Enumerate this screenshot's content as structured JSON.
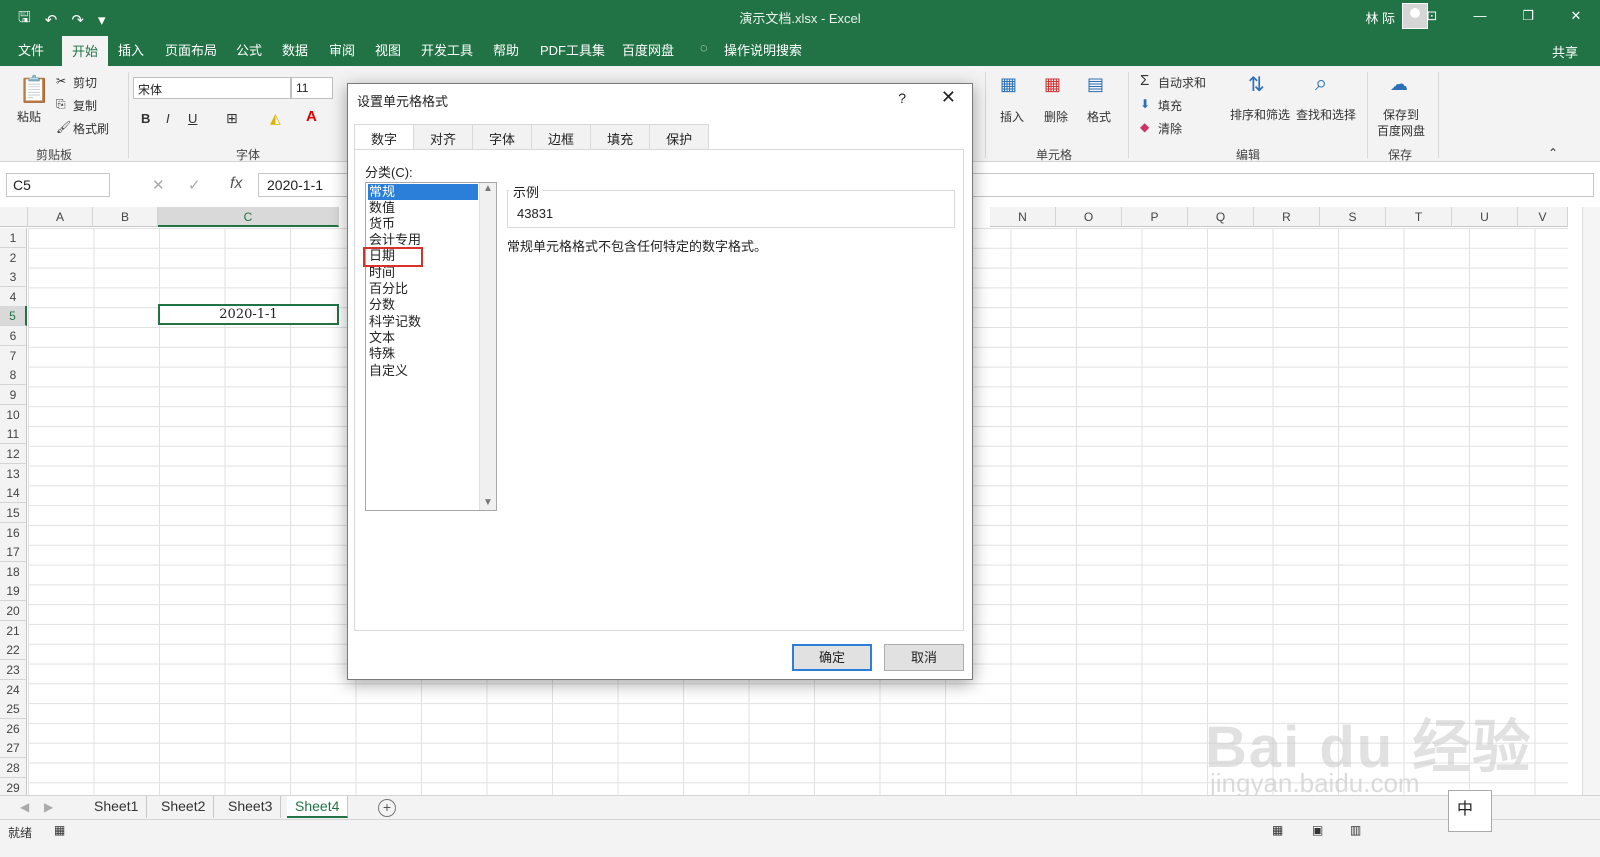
{
  "window": {
    "title": "演示文档.xlsx - Excel",
    "user": "林 际",
    "min": "—",
    "restore": "❐",
    "close": "✕",
    "ribbon_display": "⊡"
  },
  "ribbon_tabs": [
    "文件",
    "开始",
    "插入",
    "页面布局",
    "公式",
    "数据",
    "审阅",
    "视图",
    "开发工具",
    "帮助",
    "PDF工具集",
    "百度网盘",
    "操作说明搜索"
  ],
  "share": "共享",
  "ribbon": {
    "clipboard": {
      "paste": "粘贴",
      "cut": "剪切",
      "copy": "复制",
      "format_painter": "格式刷",
      "group": "剪贴板"
    },
    "font": {
      "name": "宋体",
      "size": "11",
      "group": "字体",
      "bold": "B",
      "italic": "I",
      "underline": "U"
    },
    "cells": {
      "insert": "插入",
      "delete": "删除",
      "format": "格式",
      "group": "单元格"
    },
    "editing": {
      "autosum": "自动求和",
      "fill": "填充",
      "clear": "清除",
      "sort_filter": "排序和筛选",
      "find_select": "查找和选择",
      "group": "编辑"
    },
    "save": {
      "save_to": "保存到",
      "baidu": "百度网盘",
      "group": "保存"
    }
  },
  "formula_bar": {
    "name_box": "C5",
    "fx": "fx",
    "content": "2020-1-1"
  },
  "columns": [
    "A",
    "B",
    "C",
    "",
    "",
    "",
    "",
    "",
    "",
    "",
    "",
    "",
    "",
    "N",
    "O",
    "P",
    "Q",
    "R",
    "S",
    "T",
    "U",
    "V"
  ],
  "rows": [
    "1",
    "2",
    "3",
    "4",
    "5",
    "6",
    "7",
    "8",
    "9",
    "10",
    "11",
    "12",
    "13",
    "14",
    "15",
    "16",
    "17",
    "18",
    "19",
    "20",
    "21",
    "22",
    "23",
    "24",
    "25",
    "26",
    "27",
    "28",
    "29"
  ],
  "active_cell": {
    "ref": "C5",
    "value": "2020-1-1"
  },
  "sheets": [
    "Sheet1",
    "Sheet2",
    "Sheet3",
    "Sheet4"
  ],
  "active_sheet": "Sheet4",
  "status": "就绪",
  "watermark": {
    "brand": "Bai du 经验",
    "url": "jingyan.baidu.com"
  },
  "ime": "中",
  "dialog": {
    "title": "设置单元格格式",
    "help": "?",
    "close": "✕",
    "tabs": [
      "数字",
      "对齐",
      "字体",
      "边框",
      "填充",
      "保护"
    ],
    "active_tab": "数字",
    "category_label": "分类(C):",
    "categories": [
      "常规",
      "数值",
      "货币",
      "会计专用",
      "日期",
      "时间",
      "百分比",
      "分数",
      "科学记数",
      "文本",
      "特殊",
      "自定义"
    ],
    "selected_category": "常规",
    "highlighted_category": "日期",
    "sample_label": "示例",
    "sample_value": "43831",
    "description": "常规单元格格式不包含任何特定的数字格式。",
    "ok": "确定",
    "cancel": "取消"
  },
  "colors": {
    "excel_green": "#217346",
    "highlight_red": "#d9302a",
    "select_blue": "#2b7fd8"
  }
}
